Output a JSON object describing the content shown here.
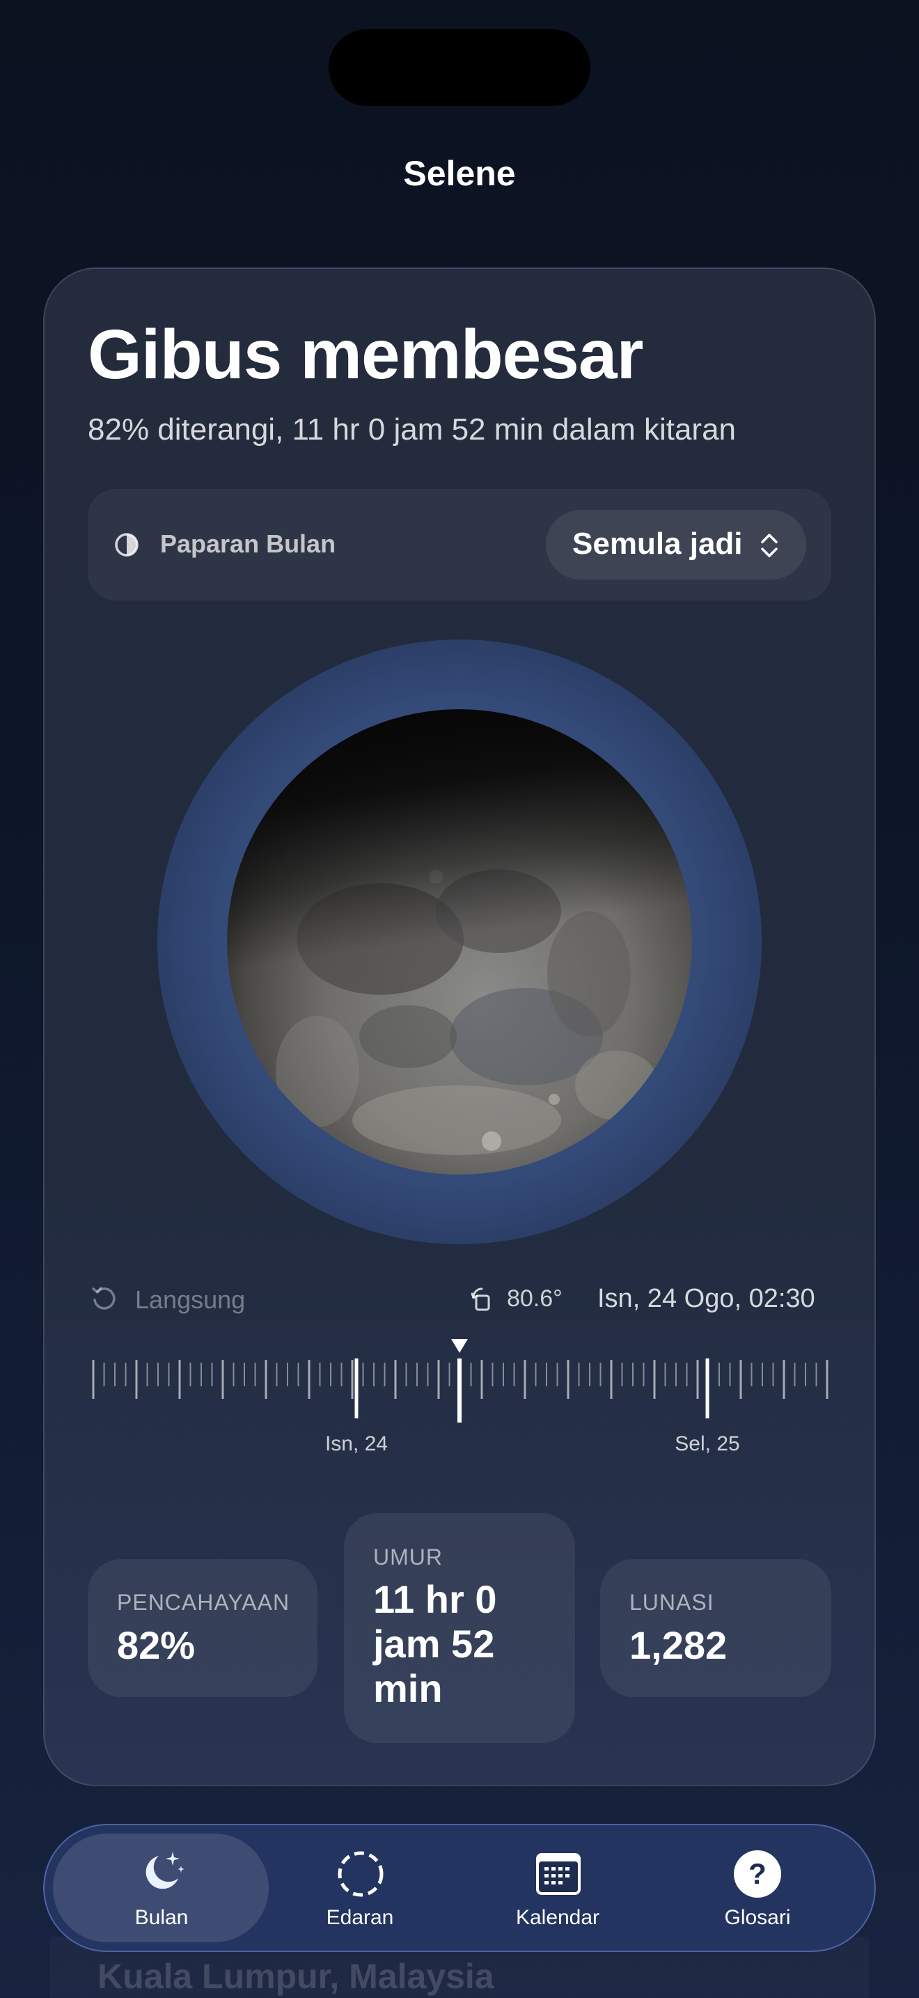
{
  "app": {
    "title": "Selene"
  },
  "phase": {
    "name": "Gibus membesar",
    "subtitle": "82% diterangi, 11 hr 0 jam 52 min dalam kitaran"
  },
  "view": {
    "label": "Paparan Bulan",
    "selected": "Semula jadi"
  },
  "timeline": {
    "live_label": "Langsung",
    "angle": "80.6°",
    "datetime": "Isn, 24 Ogo, 02:30",
    "tick_labels": [
      "Isn, 24",
      "Sel, 25"
    ]
  },
  "stats": {
    "illumination": {
      "label": "PENCAHAYAAN",
      "value": "82%"
    },
    "age": {
      "label": "UMUR",
      "value": "11 hr 0 jam 52 min"
    },
    "lunation": {
      "label": "LUNASI",
      "value": "1,282"
    }
  },
  "tabs": [
    {
      "label": "Bulan",
      "icon": "moon-stars-icon",
      "active": true
    },
    {
      "label": "Edaran",
      "icon": "dashed-circle-icon",
      "active": false
    },
    {
      "label": "Kalendar",
      "icon": "calendar-icon",
      "active": false
    },
    {
      "label": "Glosari",
      "icon": "question-icon",
      "active": false
    }
  ],
  "behind": {
    "location": "Kuala Lumpur, Malaysia"
  },
  "colors": {
    "background": "#0d1628",
    "card": "#232b3c",
    "halo": "#3a5384",
    "accent": "#ffffff"
  }
}
